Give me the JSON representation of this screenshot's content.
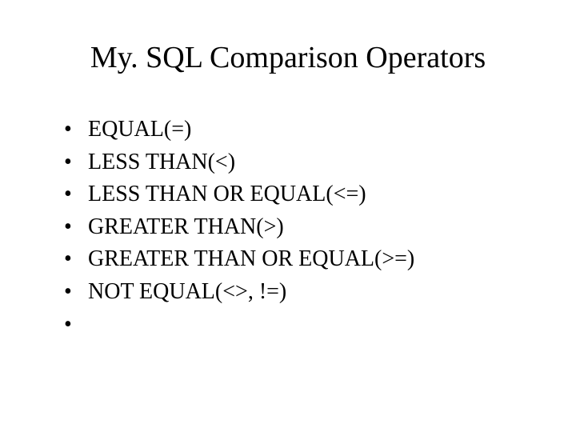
{
  "title": "My. SQL Comparison Operators",
  "bullets": {
    "b0": "EQUAL(=)",
    "b1": " LESS THAN(<)",
    "b2": "LESS THAN OR EQUAL(<=)",
    "b3": " GREATER THAN(>)",
    "b4": "GREATER THAN OR EQUAL(>=)",
    "b5": " NOT EQUAL(<>, !=)",
    "b6": ""
  }
}
